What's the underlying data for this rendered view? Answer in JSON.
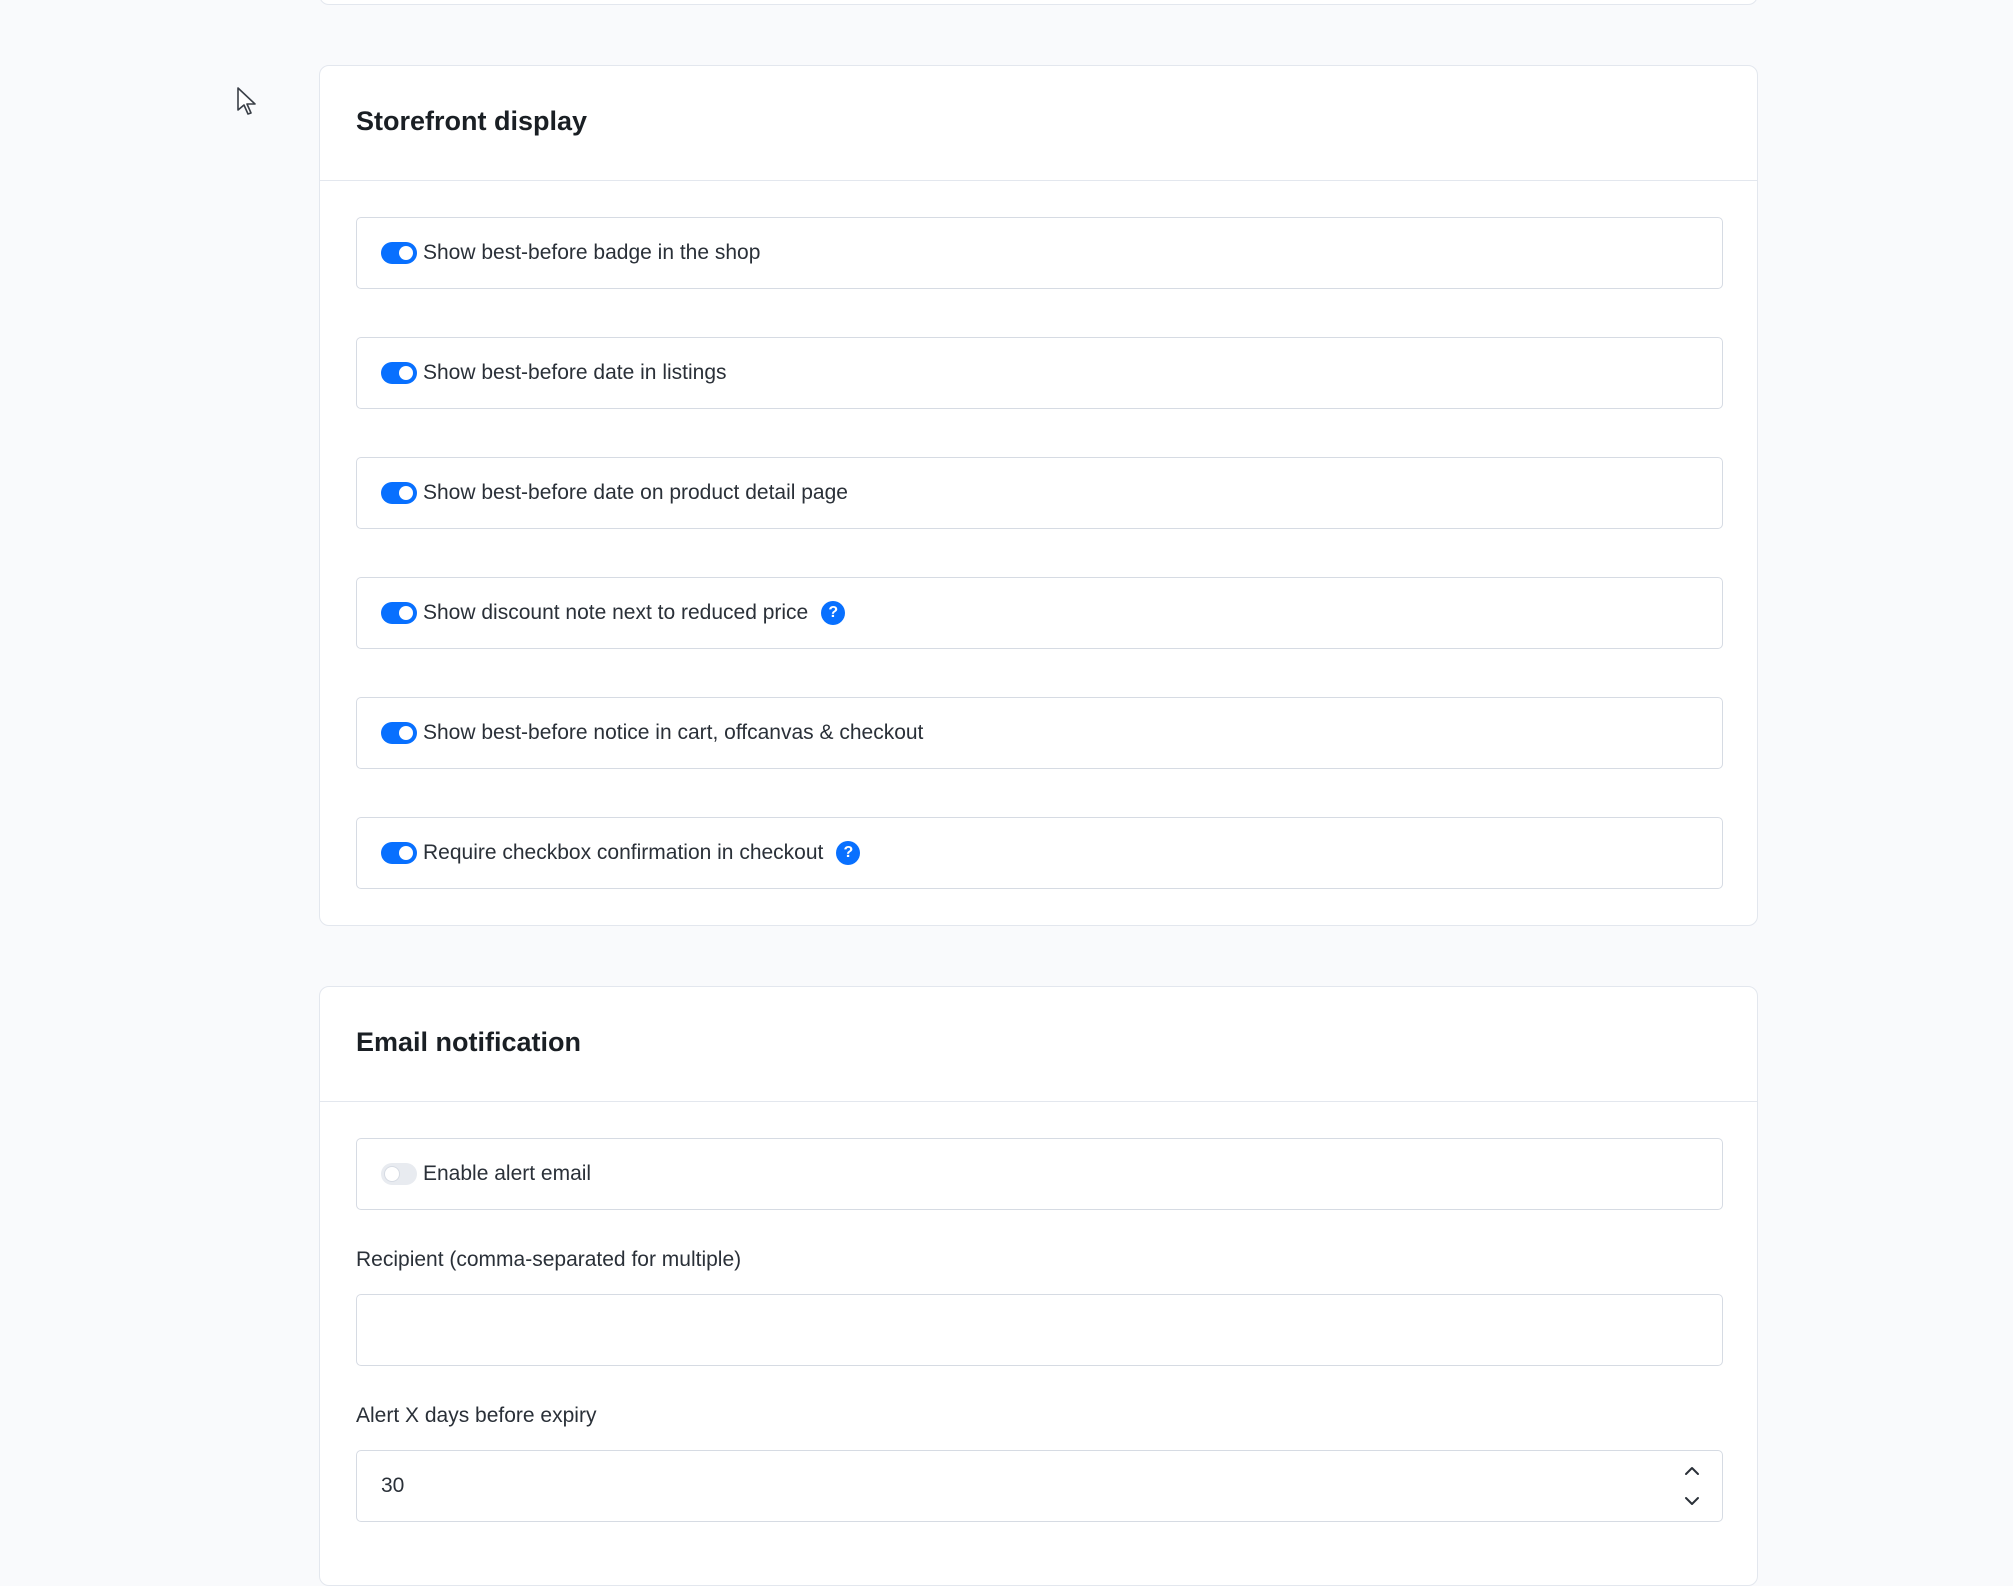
{
  "storefront": {
    "title": "Storefront display",
    "toggles": [
      {
        "label": "Show best-before badge in the shop",
        "enabled": true,
        "help": false
      },
      {
        "label": "Show best-before date in listings",
        "enabled": true,
        "help": false
      },
      {
        "label": "Show best-before date on product detail page",
        "enabled": true,
        "help": false
      },
      {
        "label": "Show discount note next to reduced price",
        "enabled": true,
        "help": true
      },
      {
        "label": "Show best-before notice in cart, offcanvas & checkout",
        "enabled": true,
        "help": false
      },
      {
        "label": "Require checkbox confirmation in checkout",
        "enabled": true,
        "help": true
      }
    ]
  },
  "email": {
    "title": "Email notification",
    "enable_alert": {
      "label": "Enable alert email",
      "enabled": false
    },
    "recipient": {
      "label": "Recipient (comma-separated for multiple)",
      "value": ""
    },
    "days_before": {
      "label": "Alert X days before expiry",
      "value": "30"
    }
  },
  "icons": {
    "help": "question-mark-icon",
    "stepper_up": "chevron-up-icon",
    "stepper_down": "chevron-down-icon",
    "pointer": "mouse-pointer-icon"
  },
  "colors": {
    "accent": "#0870ff",
    "toggle_off": "#e8ebf0",
    "background": "#f9fafc"
  },
  "help_glyph": "?"
}
